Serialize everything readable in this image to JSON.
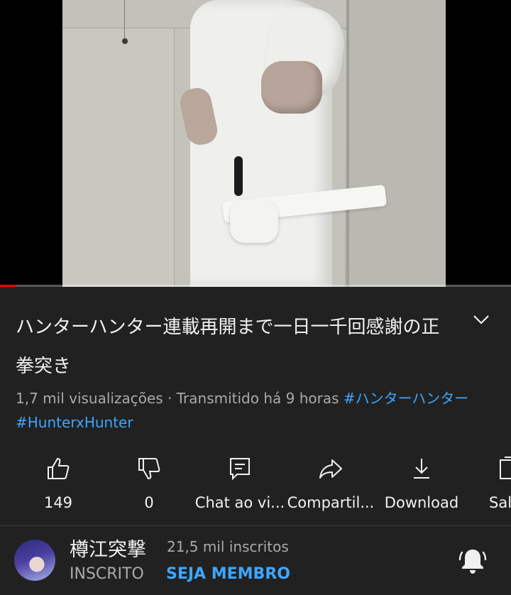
{
  "player": {
    "progress_fraction": 0.03,
    "progress_color": "#ff0000"
  },
  "video": {
    "title": "ハンターハンター連載再開まで一日一千回感謝の正拳突き",
    "views": "1,7 mil visualizações",
    "separator": " · ",
    "streamed": "Transmitido há 9 horas",
    "hashtags": [
      "#ハンターハンター",
      "#HunterxHunter"
    ]
  },
  "actions": [
    {
      "icon": "thumbs-up-icon",
      "label": "149"
    },
    {
      "icon": "thumbs-down-icon",
      "label": "0"
    },
    {
      "icon": "live-chat-icon",
      "label": "Chat ao vi..."
    },
    {
      "icon": "share-icon",
      "label": "Compartil..."
    },
    {
      "icon": "download-icon",
      "label": "Download"
    },
    {
      "icon": "save-playlist-icon",
      "label": "Sal"
    }
  ],
  "channel": {
    "name": "樽江突撃",
    "subscribers": "21,5 mil inscritos",
    "subscribed_label": "INSCRITO",
    "member_label": "SEJA MEMBRO"
  },
  "colors": {
    "background": "#212121",
    "link": "#3ea6ff",
    "secondary_text": "#aaaaaa"
  }
}
